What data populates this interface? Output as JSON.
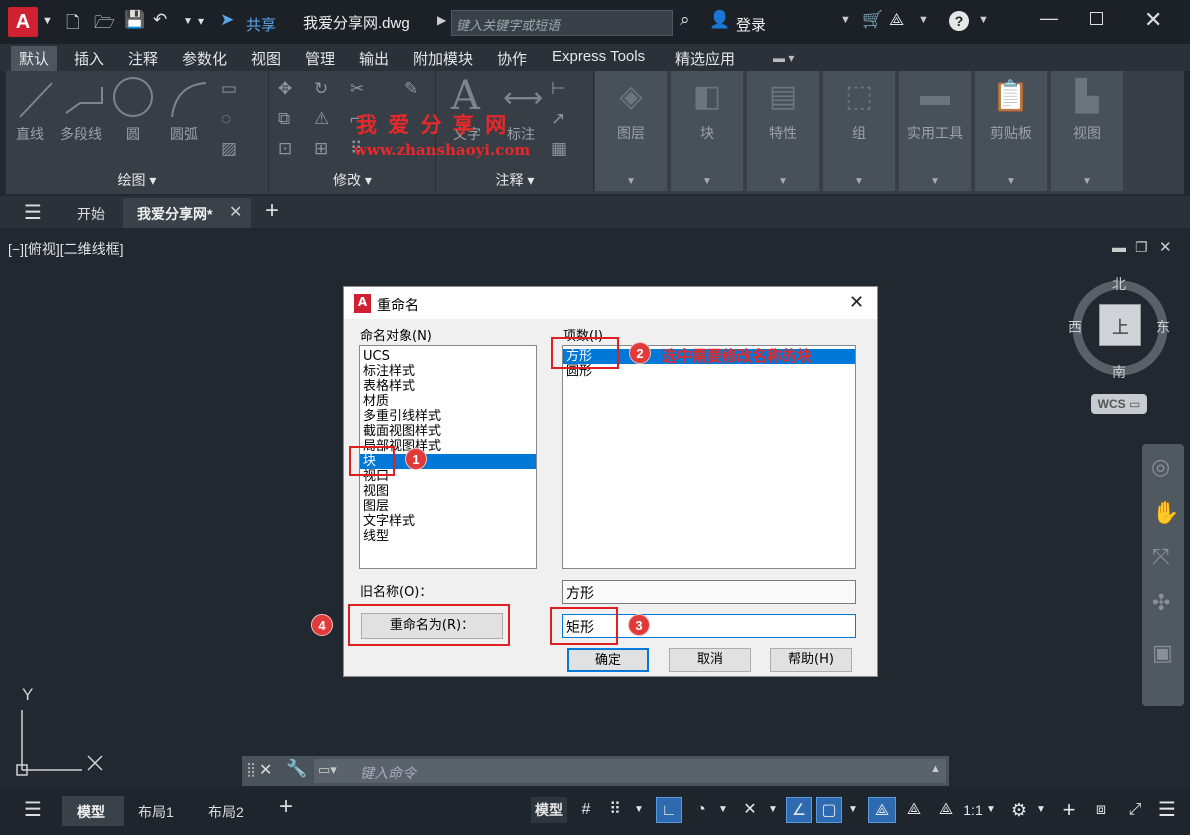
{
  "titlebar": {
    "logo": "A",
    "share_label": "共享",
    "doc_title": "我爱分享网.dwg",
    "search_placeholder": "键入关键字或短语",
    "login_label": "登录"
  },
  "ribbon_tabs": [
    "默认",
    "插入",
    "注释",
    "参数化",
    "视图",
    "管理",
    "输出",
    "附加模块",
    "协作",
    "Express Tools",
    "精选应用"
  ],
  "ribbon": {
    "draw_tools": [
      "直线",
      "多段线",
      "圆",
      "圆弧"
    ],
    "draw_title": "绘图",
    "modify_title": "修改",
    "text_tools": [
      "文字",
      "标注"
    ],
    "annotate_title": "注释",
    "groups": [
      "图层",
      "块",
      "特性",
      "组",
      "实用工具",
      "剪贴板",
      "视图"
    ]
  },
  "watermark": {
    "line1": "我 爱 分 享 网",
    "line2": "www.zhanshaoyi.com"
  },
  "doc_tabs": {
    "start": "开始",
    "current": "我爱分享网*"
  },
  "viewport": {
    "label": "[−][俯视][二维线框]",
    "compass": {
      "n": "北",
      "s": "南",
      "e": "东",
      "w": "西",
      "top": "上"
    },
    "wcs": "WCS",
    "axis_y": "Y"
  },
  "dialog": {
    "title": "重命名",
    "objects_label": "命名对象(N)",
    "items_label": "项数(I)",
    "objects": [
      "UCS",
      "标注样式",
      "表格样式",
      "材质",
      "多重引线样式",
      "截面视图样式",
      "局部视图样式",
      "块",
      "视口",
      "视图",
      "图层",
      "文字样式",
      "线型"
    ],
    "selected_object": "块",
    "items": [
      "方形",
      "圆形"
    ],
    "selected_item": "方形",
    "old_name_label": "旧名称(O)：",
    "old_name_value": "方形",
    "rename_button": "重命名为(R)：",
    "new_name_value": "矩形",
    "ok": "确定",
    "cancel": "取消",
    "help": "帮助(H)"
  },
  "annotations": {
    "b1": "1",
    "b2": "2",
    "b3": "3",
    "b4": "4",
    "note2": "选中需要修改名称的块"
  },
  "command": {
    "placeholder": "键入命令"
  },
  "statusbar": {
    "tabs": [
      "模型",
      "布局1",
      "布局2"
    ],
    "model_btn": "模型",
    "scale": "1:1"
  }
}
